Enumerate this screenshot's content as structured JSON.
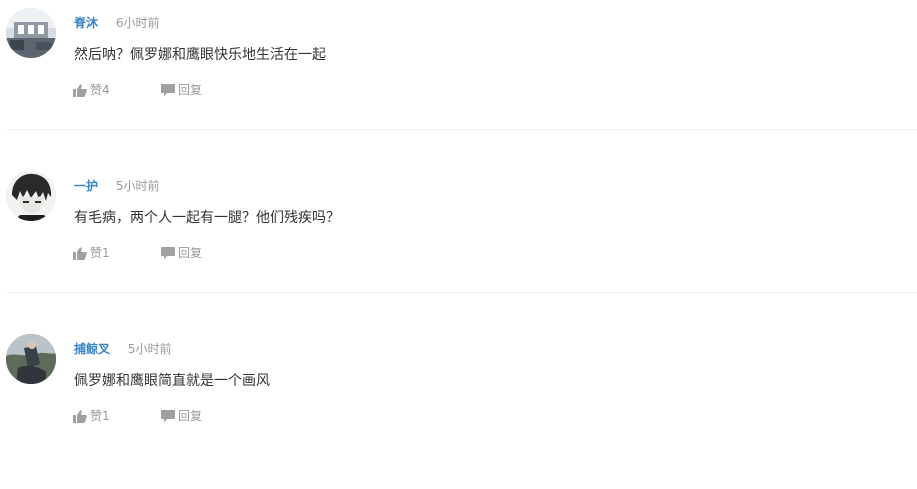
{
  "comments": [
    {
      "username": "脊沐",
      "time": "6小时前",
      "text": "然后呐？佩罗娜和鹰眼快乐地生活在一起",
      "like_label": "赞4",
      "reply_label": "回复"
    },
    {
      "username": "一护",
      "time": "5小时前",
      "text": "有毛病，两个人一起有一腿？他们残疾吗？",
      "like_label": "赞1",
      "reply_label": "回复"
    },
    {
      "username": "捕鲸叉",
      "time": "5小时前",
      "text": "佩罗娜和鹰眼简直就是一个画风",
      "like_label": "赞1",
      "reply_label": "回复"
    }
  ],
  "colors": {
    "username": "#3a84c4",
    "muted": "#999999",
    "text": "#333333",
    "divider": "#eeeeee"
  },
  "icons": {
    "like": "thumbs-up-icon",
    "reply": "speech-bubble-icon"
  }
}
